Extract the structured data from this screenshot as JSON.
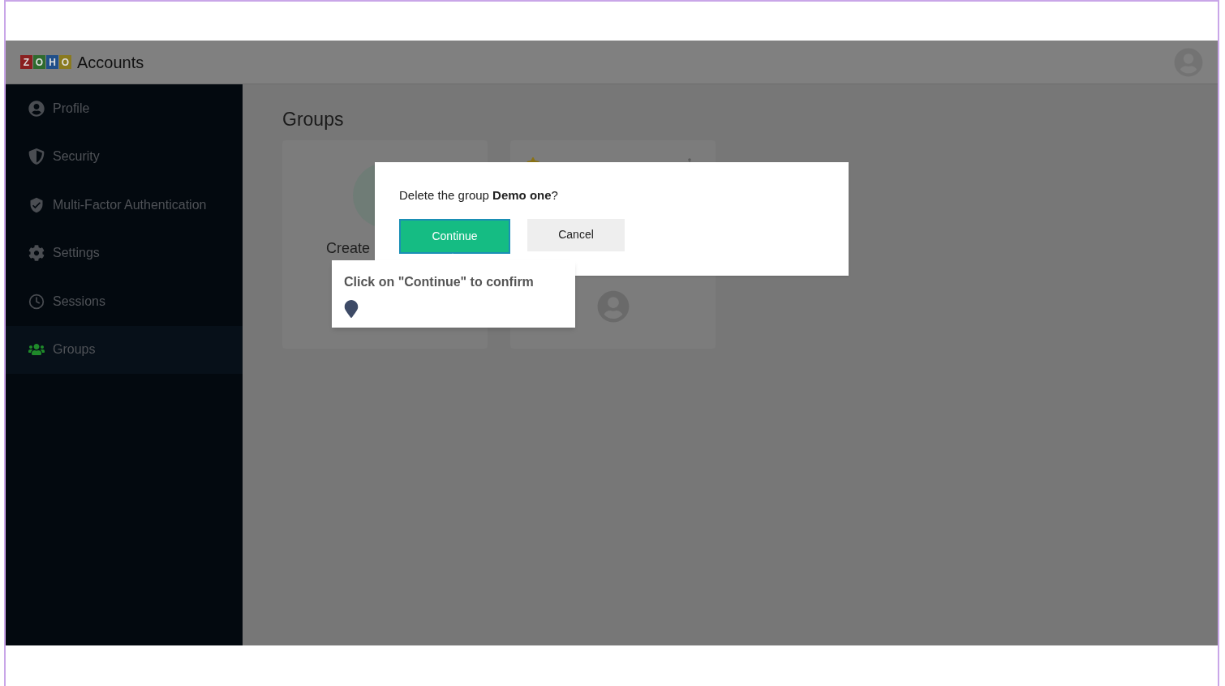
{
  "header": {
    "logo_letters": [
      {
        "letter": "Z",
        "color": "#8a1f1f"
      },
      {
        "letter": "O",
        "color": "#2e6b2e"
      },
      {
        "letter": "H",
        "color": "#1f4f8a"
      },
      {
        "letter": "O",
        "color": "#8a7a1f"
      }
    ],
    "title": "Accounts"
  },
  "sidebar": {
    "items": [
      {
        "label": "Profile",
        "kind": "profile",
        "selected": false
      },
      {
        "label": "Security",
        "kind": "shield",
        "selected": false
      },
      {
        "label": "Multi-Factor Authentication",
        "kind": "shield-check",
        "selected": false
      },
      {
        "label": "Settings",
        "kind": "gear",
        "selected": false
      },
      {
        "label": "Sessions",
        "kind": "clock",
        "selected": false
      },
      {
        "label": "Groups",
        "kind": "users",
        "selected": true
      }
    ]
  },
  "main": {
    "title": "Groups",
    "cards": [
      {
        "kind": "create",
        "label": "Create"
      },
      {
        "kind": "group",
        "starred": true
      }
    ]
  },
  "dialog": {
    "message": "Delete the group **Demo one**?",
    "buttons": [
      {
        "label": "Continue",
        "kind": "primary"
      },
      {
        "label": "Cancel",
        "kind": "secondary"
      }
    ]
  },
  "tooltip": {
    "text": "Click on \"Continue\" to confirm"
  }
}
